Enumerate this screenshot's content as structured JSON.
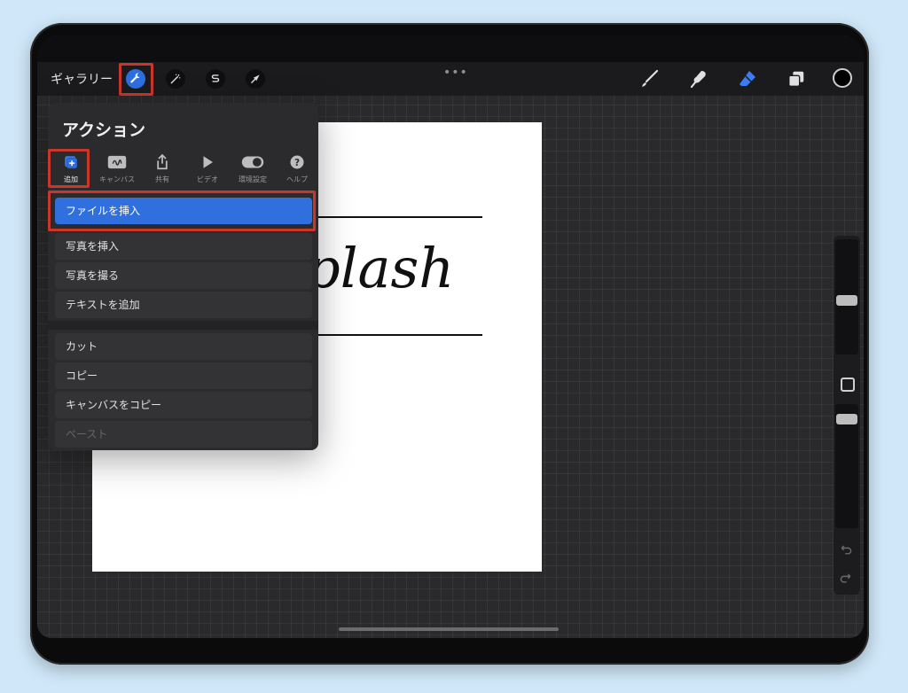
{
  "toolbar": {
    "gallery_label": "ギャラリー",
    "more_dots": "•••",
    "color": "#000000"
  },
  "canvas": {
    "word": "plash"
  },
  "actions": {
    "title": "アクション",
    "tabs": [
      {
        "label": "追加",
        "icon": "add-icon",
        "active": true
      },
      {
        "label": "キャンバス",
        "icon": "canvas-icon"
      },
      {
        "label": "共有",
        "icon": "share-icon"
      },
      {
        "label": "ビデオ",
        "icon": "video-play-icon"
      },
      {
        "label": "環境設定",
        "icon": "toggle-icon"
      },
      {
        "label": "ヘルプ",
        "icon": "help-icon"
      }
    ],
    "items": [
      {
        "label": "ファイルを挿入",
        "active": true
      },
      {
        "label": "写真を挿入"
      },
      {
        "label": "写真を撮る"
      },
      {
        "label": "テキストを追加"
      },
      {
        "label": "カット"
      },
      {
        "label": "コピー"
      },
      {
        "label": "キャンバスをコピー"
      },
      {
        "label": "ペースト",
        "disabled": true
      }
    ]
  },
  "colors": {
    "accent": "#2f6fde",
    "highlight_box": "#c8372a"
  }
}
